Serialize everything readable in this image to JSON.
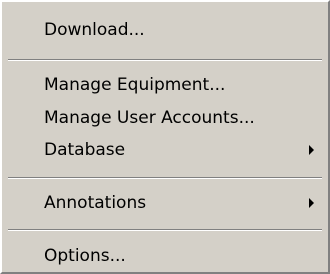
{
  "menu": {
    "items": [
      {
        "label": "Download..."
      },
      {
        "label": "Manage Equipment..."
      },
      {
        "label": "Manage User Accounts..."
      },
      {
        "label": "Database"
      },
      {
        "label": "Annotations"
      },
      {
        "label": "Options..."
      }
    ],
    "submenu_arrow_icon": "triangle-right-icon"
  }
}
